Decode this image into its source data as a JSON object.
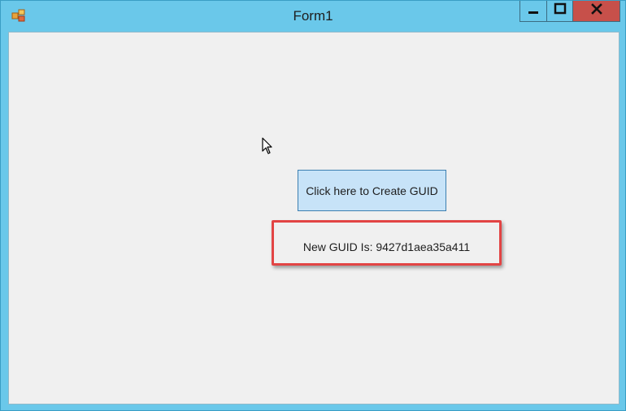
{
  "window": {
    "title": "Form1",
    "app_icon": "winforms-app-icon",
    "controls": {
      "minimize_icon": "minimize-icon",
      "maximize_icon": "maximize-icon",
      "close_icon": "close-icon"
    }
  },
  "form": {
    "button_label": "Click here to Create GUID",
    "guid_label": "New GUID Is: 9427d1aea35a411"
  },
  "colors": {
    "titlebar": "#6ac8ea",
    "close_button": "#c7504a",
    "client_background": "#f0f0f0",
    "button_background": "#c7e3f8",
    "button_border": "#3c7fb1",
    "highlight_border": "#e24444"
  }
}
